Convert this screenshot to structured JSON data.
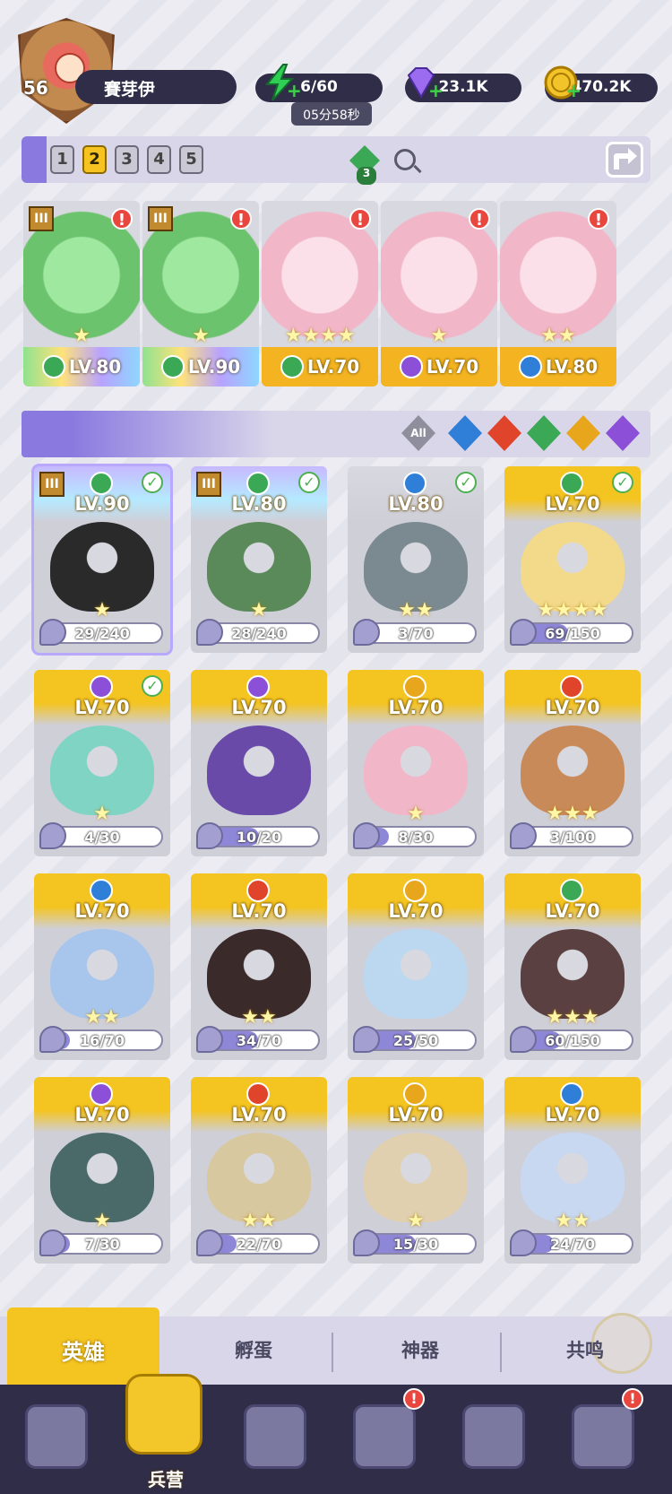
{
  "player": {
    "level": "56",
    "name": "賽芽伊"
  },
  "resources": {
    "energy": "6/60",
    "energy_timer": "05分58秒",
    "gems": "23.1K",
    "coins": "470.2K"
  },
  "team_tabs": [
    "1",
    "2",
    "3",
    "4",
    "5"
  ],
  "team_tab_active": 1,
  "team_gem_count": "3",
  "team": [
    {
      "level": "LV.80",
      "element_color": "#3aa855",
      "style": "rainbow",
      "stars": "★",
      "alert": "!",
      "rank": "III"
    },
    {
      "level": "LV.90",
      "element_color": "#3aa855",
      "style": "rainbow",
      "stars": "★",
      "alert": "!",
      "rank": "III"
    },
    {
      "level": "LV.70",
      "element_color": "#3aa855",
      "style": "gold",
      "stars": "★★★★",
      "alert": "!",
      "rank": ""
    },
    {
      "level": "LV.70",
      "element_color": "#8b4fd8",
      "style": "gold",
      "stars": "★",
      "alert": "!",
      "rank": ""
    },
    {
      "level": "LV.80",
      "element_color": "#2f7ed8",
      "style": "gold",
      "stars": "★★",
      "alert": "!",
      "rank": ""
    }
  ],
  "filters": {
    "all_label": "All",
    "elements": [
      {
        "name": "water-element-icon",
        "color": "#2f7ed8"
      },
      {
        "name": "fire-element-icon",
        "color": "#e0442a"
      },
      {
        "name": "nature-element-icon",
        "color": "#3aa855"
      },
      {
        "name": "light-element-icon",
        "color": "#e8a61c"
      },
      {
        "name": "dark-element-icon",
        "color": "#8b4fd8"
      }
    ]
  },
  "heroes": [
    {
      "level": "LV.90",
      "element_color": "#3aa855",
      "style": "rainbow",
      "stars": "★",
      "progress": "29/240",
      "fraction": 0.12,
      "checked": true,
      "rank": "III",
      "art": "#2a2a2a"
    },
    {
      "level": "LV.80",
      "element_color": "#3aa855",
      "style": "rainbow",
      "stars": "★",
      "progress": "28/240",
      "fraction": 0.12,
      "checked": true,
      "rank": "III",
      "art": "#5a8a5a"
    },
    {
      "level": "LV.80",
      "element_color": "#2f7ed8",
      "style": "gray",
      "stars": "★★",
      "progress": "3/70",
      "fraction": 0.04,
      "checked": true,
      "rank": "",
      "art": "#7a8a90"
    },
    {
      "level": "LV.70",
      "element_color": "#3aa855",
      "style": "gold",
      "stars": "★★★★",
      "progress": "69/150",
      "fraction": 0.46,
      "checked": true,
      "rank": "",
      "art": "#f3d98a"
    },
    {
      "level": "LV.70",
      "element_color": "#8b4fd8",
      "style": "gold",
      "stars": "★",
      "progress": "4/30",
      "fraction": 0.13,
      "checked": true,
      "rank": "",
      "art": "#7fd4c4"
    },
    {
      "level": "LV.70",
      "element_color": "#8b4fd8",
      "style": "gold",
      "stars": "",
      "progress": "10/20",
      "fraction": 0.5,
      "checked": false,
      "rank": "",
      "art": "#6a4aa8"
    },
    {
      "level": "LV.70",
      "element_color": "#e8a61c",
      "style": "gold",
      "stars": "★",
      "progress": "8/30",
      "fraction": 0.27,
      "checked": false,
      "rank": "",
      "art": "#f1b6c8"
    },
    {
      "level": "LV.70",
      "element_color": "#e0442a",
      "style": "gold",
      "stars": "★★★",
      "progress": "3/100",
      "fraction": 0.03,
      "checked": false,
      "rank": "",
      "art": "#c98a5a"
    },
    {
      "level": "LV.70",
      "element_color": "#2f7ed8",
      "style": "gold",
      "stars": "★★",
      "progress": "16/70",
      "fraction": 0.23,
      "checked": false,
      "rank": "",
      "art": "#a8c6ec"
    },
    {
      "level": "LV.70",
      "element_color": "#e0442a",
      "style": "gold",
      "stars": "★★",
      "progress": "34/70",
      "fraction": 0.49,
      "checked": false,
      "rank": "",
      "art": "#3a2a2a"
    },
    {
      "level": "LV.70",
      "element_color": "#e8a61c",
      "style": "gold",
      "stars": "",
      "progress": "25/50",
      "fraction": 0.5,
      "checked": false,
      "rank": "",
      "art": "#bcd8f0"
    },
    {
      "level": "LV.70",
      "element_color": "#3aa855",
      "style": "gold",
      "stars": "★★★",
      "progress": "60/150",
      "fraction": 0.4,
      "checked": false,
      "rank": "",
      "art": "#5a4040"
    },
    {
      "level": "LV.70",
      "element_color": "#8b4fd8",
      "style": "gold",
      "stars": "★",
      "progress": "7/30",
      "fraction": 0.23,
      "checked": false,
      "rank": "",
      "art": "#4a6a6a"
    },
    {
      "level": "LV.70",
      "element_color": "#e0442a",
      "style": "gold",
      "stars": "★★",
      "progress": "22/70",
      "fraction": 0.31,
      "checked": false,
      "rank": "",
      "art": "#d8c8a0"
    },
    {
      "level": "LV.70",
      "element_color": "#e8a61c",
      "style": "gold",
      "stars": "★",
      "progress": "15/30",
      "fraction": 0.5,
      "checked": false,
      "rank": "",
      "art": "#e0d0b0"
    },
    {
      "level": "LV.70",
      "element_color": "#2f7ed8",
      "style": "gold",
      "stars": "★★",
      "progress": "24/70",
      "fraction": 0.34,
      "checked": false,
      "rank": "",
      "art": "#c8d8f0"
    }
  ],
  "subtabs": [
    "英雄",
    "孵蛋",
    "神器",
    "共鸣"
  ],
  "subtab_active": 0,
  "nav": [
    {
      "icon": "cards-icon",
      "label": "",
      "alert": false
    },
    {
      "icon": "barracks-icon",
      "label": "兵营",
      "alert": false,
      "active": true
    },
    {
      "icon": "map-icon",
      "label": "",
      "alert": false
    },
    {
      "icon": "castle-icon",
      "label": "",
      "alert": true
    },
    {
      "icon": "mushroom-house-icon",
      "label": "",
      "alert": false
    },
    {
      "icon": "banner-icon",
      "label": "",
      "alert": true
    }
  ]
}
